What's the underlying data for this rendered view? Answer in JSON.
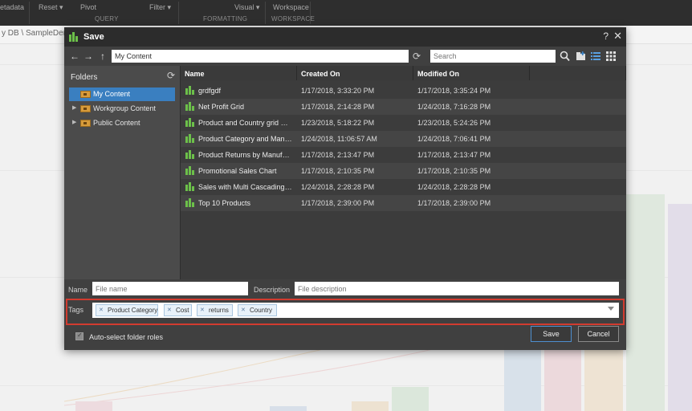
{
  "background": {
    "ribbon": {
      "items": [
        "etadata",
        "Reset ▾",
        "Pivot",
        "Filter ▾",
        "Visual ▾",
        "Workspace"
      ],
      "groups": [
        "QUERY",
        "FORMATTING",
        "WORKSPACE"
      ]
    },
    "breadcrumb": "y DB \\ SampleDemo"
  },
  "dialog": {
    "title": "Save",
    "help_label": "?",
    "close_label": "✕",
    "path_value": "My Content",
    "search_placeholder": "Search",
    "folders": {
      "title": "Folders",
      "items": [
        {
          "label": "My Content"
        },
        {
          "label": "Workgroup Content"
        },
        {
          "label": "Public Content"
        }
      ]
    },
    "columns": [
      "Name",
      "Created On",
      "Modified On"
    ],
    "files": [
      {
        "name": "grdfgdf",
        "created": "1/17/2018, 3:33:20 PM",
        "modified": "1/17/2018, 3:35:24 PM"
      },
      {
        "name": "Net Profit Grid",
        "created": "1/17/2018, 2:14:28 PM",
        "modified": "1/24/2018, 7:16:28 PM"
      },
      {
        "name": "Product and Country grid wi...",
        "created": "1/23/2018, 5:18:22 PM",
        "modified": "1/23/2018, 5:24:26 PM"
      },
      {
        "name": "Product Category and Manu...",
        "created": "1/24/2018, 11:06:57 AM",
        "modified": "1/24/2018, 7:06:41 PM"
      },
      {
        "name": "Product Returns by Manufac...",
        "created": "1/17/2018, 2:13:47 PM",
        "modified": "1/17/2018, 2:13:47 PM"
      },
      {
        "name": "Promotional Sales Chart",
        "created": "1/17/2018, 2:10:35 PM",
        "modified": "1/17/2018, 2:10:35 PM"
      },
      {
        "name": "Sales with Multi Cascading S...",
        "created": "1/24/2018, 2:28:28 PM",
        "modified": "1/24/2018, 2:28:28 PM"
      },
      {
        "name": "Top 10 Products",
        "created": "1/17/2018, 2:39:00 PM",
        "modified": "1/17/2018, 2:39:00 PM"
      }
    ],
    "name_label": "Name",
    "name_placeholder": "File name",
    "description_label": "Description",
    "description_placeholder": "File description",
    "tags_label": "Tags",
    "tags": [
      "Product Category",
      "Cost",
      "returns",
      "Country"
    ],
    "autoselect_label": "Auto-select folder roles",
    "autoselect_checked": true,
    "save_label": "Save",
    "cancel_label": "Cancel",
    "colors": {
      "accent": "#3a7fc0",
      "highlight_outline": "#d23b2f",
      "chart_icon": "#6cc04a"
    }
  }
}
